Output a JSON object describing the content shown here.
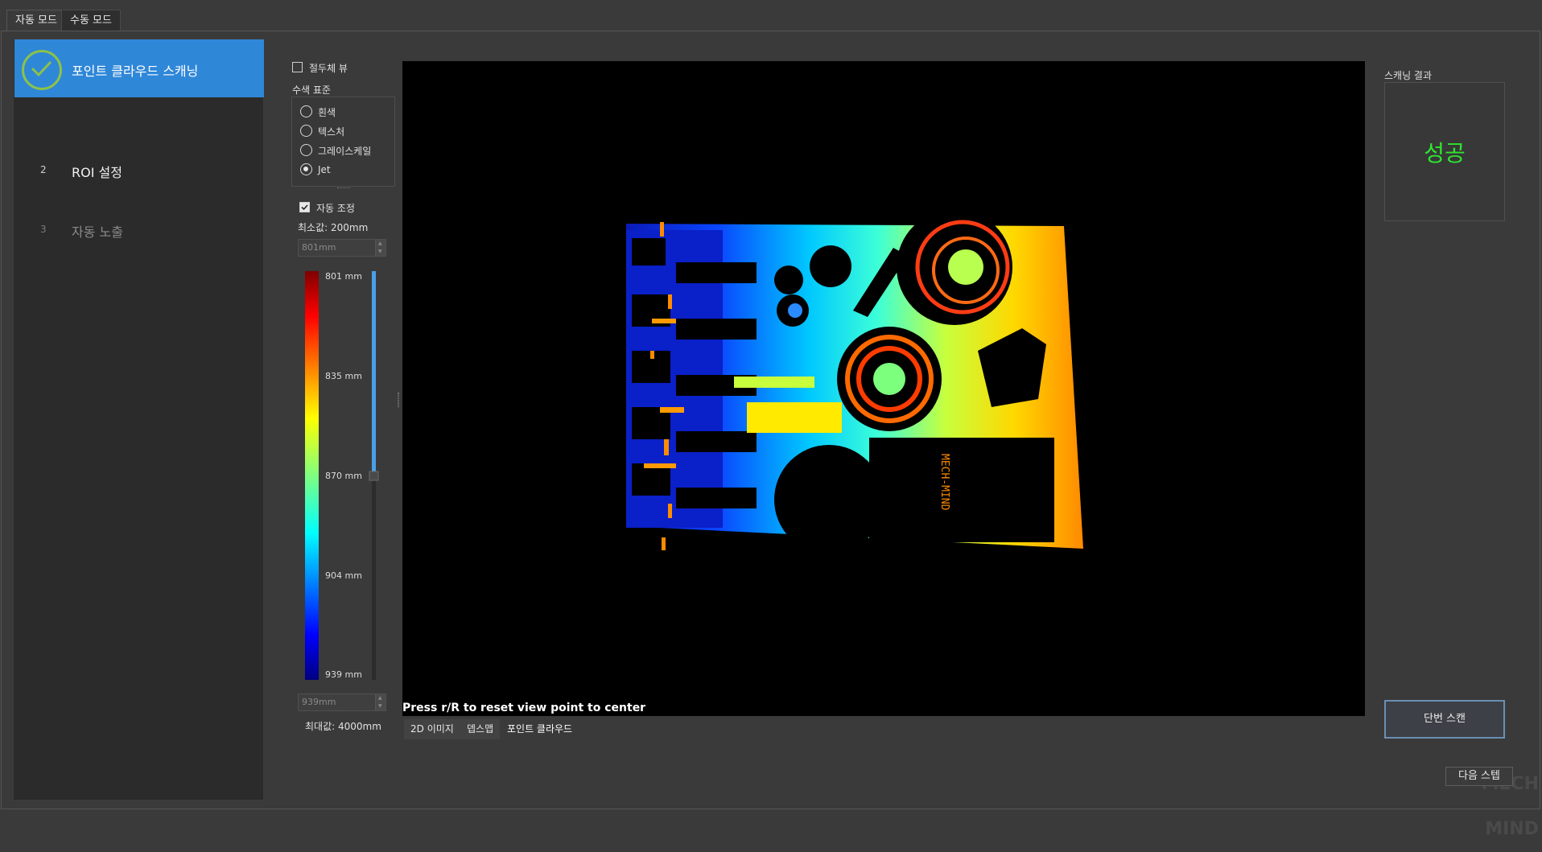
{
  "mode_tabs": [
    {
      "label": "자동 모드",
      "active": true
    },
    {
      "label": "수동 모드",
      "active": false
    }
  ],
  "steps": [
    {
      "number": "",
      "label": "포인트 클라우드 스캐닝",
      "state": "done"
    },
    {
      "number": "2",
      "label": "ROI 설정",
      "state": "pending"
    },
    {
      "number": "3",
      "label": "자동 노출",
      "state": "disabled"
    }
  ],
  "view_options": {
    "absolute_view_label": "절두체 뷰",
    "absolute_view_checked": false,
    "color_group_label": "수색 표준",
    "color_options": [
      {
        "label": "흰색",
        "checked": false
      },
      {
        "label": "텍스처",
        "checked": false
      },
      {
        "label": "그레이스케일",
        "checked": false
      },
      {
        "label": "Jet",
        "checked": true
      }
    ],
    "auto_adjust_label": "자동 조정",
    "auto_adjust_checked": true,
    "min_label": "최소값: 200mm",
    "min_input_value": "801mm",
    "max_input_value": "939mm",
    "max_label": "최대값: 4000mm"
  },
  "colorbar": {
    "ticks": [
      "801 mm",
      "835 mm",
      "870 mm",
      "904 mm",
      "939 mm"
    ],
    "slider_position": 0.5
  },
  "viewer": {
    "hint": "Press r/R to reset view point to center",
    "tabs": [
      {
        "label": "2D 이미지",
        "active": false
      },
      {
        "label": "뎁스맵",
        "active": false
      },
      {
        "label": "포인트 클라우드",
        "active": true
      }
    ]
  },
  "result": {
    "label": "스캐닝 결과",
    "value": "성공",
    "value_color": "#2ee62e"
  },
  "buttons": {
    "scan": "단번 스캔",
    "next": "다음 스텝"
  },
  "depth_image_text": "MECH-MIND",
  "watermark": "MECH MIND",
  "colors": {
    "accent": "#2f87d8",
    "check": "#8bc24a"
  }
}
